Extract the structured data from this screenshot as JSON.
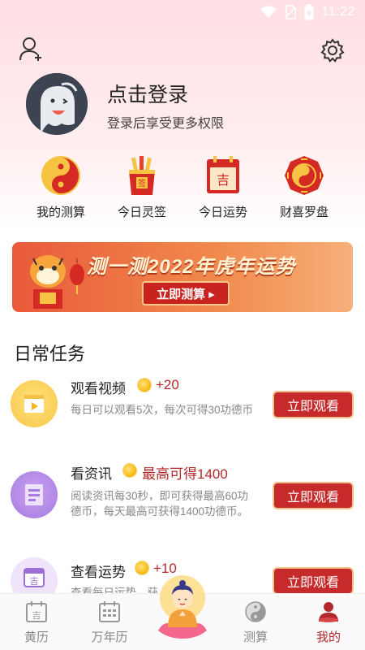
{
  "status_bar": {
    "time": "11:22",
    "icons": [
      "wifi-icon",
      "no-sim-icon",
      "battery-icon"
    ]
  },
  "header": {
    "profile_icon": "add-user-icon",
    "settings_icon": "gear-icon",
    "login_title": "点击登录",
    "login_subtitle": "登录后享受更多权限"
  },
  "quick_actions": [
    {
      "label": "我的测算",
      "icon": "yin-yang-icon"
    },
    {
      "label": "今日灵签",
      "icon": "fortune-sticks-icon"
    },
    {
      "label": "今日运势",
      "icon": "calendar-ji-icon"
    },
    {
      "label": "财喜罗盘",
      "icon": "bagua-compass-icon"
    }
  ],
  "banner": {
    "title": "测一测2022年虎年运势",
    "button_label": "立即测算 ▸"
  },
  "daily_tasks": {
    "title": "日常任务",
    "items": [
      {
        "name": "观看视频",
        "reward": "+20",
        "description": "每日可以观看5次，每次可得30功德币",
        "button_label": "立即观看",
        "icon": "video-play-icon"
      },
      {
        "name": "看资讯",
        "reward": "最高可得1400",
        "description": "阅读资讯每30秒，即可获得最高60功德币，每天最高可获得1400功德币。",
        "button_label": "立即观看",
        "icon": "news-document-icon"
      },
      {
        "name": "查看运势",
        "reward": "+10",
        "description": "查看每日运势，获",
        "button_label": "立即观看",
        "icon": "calendar-ji-icon"
      }
    ]
  },
  "tab_bar": {
    "items": [
      {
        "label": "黄历",
        "icon": "calendar-ji-icon"
      },
      {
        "label": "万年历",
        "icon": "calendar-grid-icon"
      },
      {
        "label": "测算",
        "icon": "yin-yang-icon"
      },
      {
        "label": "我的",
        "icon": "user-icon"
      }
    ],
    "center_icon": "buddha-icon"
  },
  "colors": {
    "accent": "#b3282a",
    "button_red": "#c62a2a",
    "header_pink": "#ffe1e5",
    "coin_gold": "#f7b80b"
  }
}
